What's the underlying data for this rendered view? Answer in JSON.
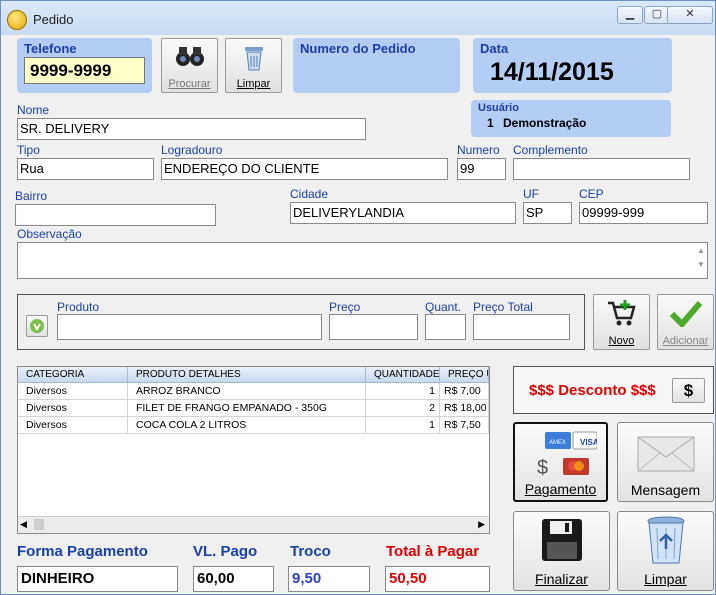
{
  "window": {
    "title": "Pedido"
  },
  "telefone": {
    "label": "Telefone",
    "value": "9999-9999"
  },
  "buttons": {
    "procurar": "Procurar",
    "limpar_top": "Limpar",
    "novo": "Novo",
    "adicionar": "Adicionar",
    "pagamento": "Pagamento",
    "mensagem": "Mensagem",
    "finalizar": "Finalizar",
    "limpar_bottom": "Limpar",
    "desconto_btn": "$"
  },
  "pedido": {
    "label": "Numero do Pedido"
  },
  "data": {
    "label": "Data",
    "value": "14/11/2015"
  },
  "usuario": {
    "label": "Usuário",
    "id": "1",
    "name": "Demonstração"
  },
  "form": {
    "nome_label": "Nome",
    "nome": "SR. DELIVERY",
    "tipo_label": "Tipo",
    "tipo": "Rua",
    "logradouro_label": "Logradouro",
    "logradouro": "ENDEREÇO DO CLIENTE",
    "numero_label": "Numero",
    "numero": "99",
    "complemento_label": "Complemento",
    "complemento": "",
    "bairro_label": "Bairro",
    "bairro": "",
    "cidade_label": "Cidade",
    "cidade": "DELIVERYLANDIA",
    "uf_label": "UF",
    "uf": "SP",
    "cep_label": "CEP",
    "cep": "09999-999",
    "obs_label": "Observação",
    "obs": ""
  },
  "produto": {
    "produto_label": "Produto",
    "preco_label": "Preço",
    "quant_label": "Quant.",
    "preco_total_label": "Preço Total"
  },
  "grid": {
    "headers": [
      "CATEGORIA",
      "PRODUTO DETALHES",
      "QUANTIDADE",
      "PREÇO U"
    ],
    "rows": [
      {
        "categoria": "Diversos",
        "produto": "ARROZ BRANCO",
        "quantidade": "1",
        "preco": "R$ 7,00"
      },
      {
        "categoria": "Diversos",
        "produto": "FILET DE FRANGO EMPANADO - 350G",
        "quantidade": "2",
        "preco": "R$ 18,00"
      },
      {
        "categoria": "Diversos",
        "produto": "COCA COLA 2 LITROS",
        "quantidade": "1",
        "preco": "R$ 7,50"
      }
    ]
  },
  "desconto": {
    "label": "$$$ Desconto $$$"
  },
  "footer": {
    "forma_label": "Forma Pagamento",
    "forma": "DINHEIRO",
    "vl_label": "VL. Pago",
    "vl": "60,00",
    "troco_label": "Troco",
    "troco": "9,50",
    "total_label": "Total à Pagar",
    "total": "50,50"
  },
  "colors": {
    "accent": "#1a3fa8",
    "panel": "#b4cdf4",
    "total": "#e00000",
    "troco": "#2a3fd0"
  }
}
